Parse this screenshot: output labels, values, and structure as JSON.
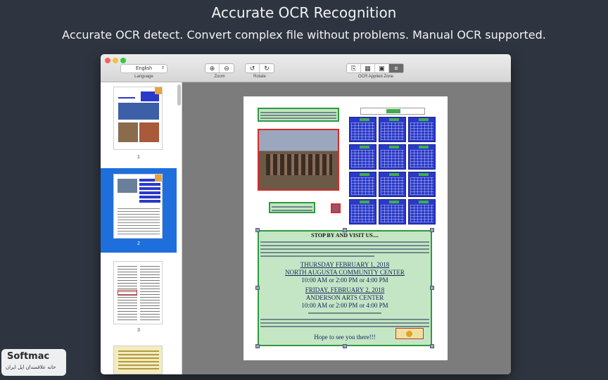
{
  "hero": {
    "title": "Accurate OCR Recognition",
    "subtitle": "Accurate OCR detect. Convert complex file without problems. Manual OCR supported."
  },
  "toolbar": {
    "language_value": "English",
    "language_label": "Language",
    "zoom_label": "Zoom",
    "rotate_label": "Rotate",
    "zone_label": "OCR Applied Zone",
    "zoom_in_icon": "zoom-in-icon",
    "zoom_out_icon": "zoom-out-icon",
    "rotate_left_icon": "rotate-left-icon",
    "rotate_right_icon": "rotate-right-icon"
  },
  "sidebar": {
    "pages": [
      {
        "number": "1",
        "selected": false
      },
      {
        "number": "2",
        "selected": true
      },
      {
        "number": "3",
        "selected": false
      },
      {
        "number": "",
        "selected": false
      }
    ]
  },
  "document": {
    "heading": "STOP BY AND VISIT US....",
    "event1_date": "THURSDAY FEBRUARY 1, 2018",
    "event1_place": "NORTH AUGUSTA COMMUNITY CENTER",
    "event1_times": "10:00 AM   or  2:00 PM   or   4:00 PM",
    "event2_date": "FRIDAY, FEBRUARY 2, 2018",
    "event2_place": "ANDERSON ARTS CENTER",
    "event2_times": "10:00 AM   or  2:00 PM   or   4:00 PM",
    "closing": "Hope to see you there!!!"
  },
  "watermark": {
    "brand": "Softmac",
    "tagline": "خانه علاقمندان اپل ایران"
  },
  "colors": {
    "zone_green": "#2e9a3e",
    "zone_blue": "#2a39c9",
    "zone_red": "#d52b2b",
    "selection_blue": "#1e6fdc"
  }
}
